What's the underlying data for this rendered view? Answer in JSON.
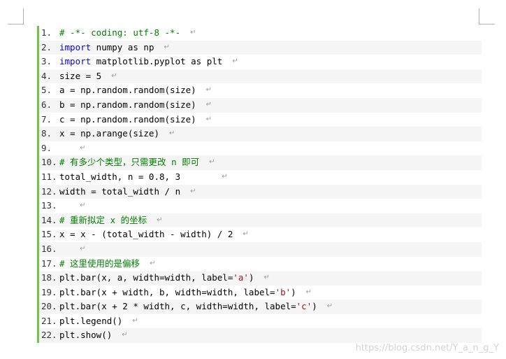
{
  "lines": [
    {
      "num": "1.",
      "segments": [
        {
          "t": "# -*- coding: utf-8 -*-",
          "c": "cm"
        }
      ]
    },
    {
      "num": "2.",
      "segments": [
        {
          "t": "import",
          "c": "kw"
        },
        {
          "t": " numpy as np",
          "c": ""
        }
      ]
    },
    {
      "num": "3.",
      "segments": [
        {
          "t": "import",
          "c": "kw"
        },
        {
          "t": " matplotlib.pyplot as plt",
          "c": ""
        }
      ]
    },
    {
      "num": "4.",
      "segments": [
        {
          "t": "size = 5",
          "c": ""
        }
      ]
    },
    {
      "num": "5.",
      "segments": [
        {
          "t": "a = np.random.random(size)",
          "c": ""
        }
      ]
    },
    {
      "num": "6.",
      "segments": [
        {
          "t": "b = np.random.random(size)",
          "c": ""
        }
      ]
    },
    {
      "num": "7.",
      "segments": [
        {
          "t": "c = np.random.random(size)",
          "c": ""
        }
      ]
    },
    {
      "num": "8.",
      "segments": [
        {
          "t": "x = np.arange(size)",
          "c": ""
        }
      ]
    },
    {
      "num": "9.",
      "segments": [
        {
          "t": "  ",
          "c": ""
        }
      ]
    },
    {
      "num": "10.",
      "segments": [
        {
          "t": "# 有多少个类型，只需更改 n 即可",
          "c": "cm"
        }
      ]
    },
    {
      "num": "11.",
      "segments": [
        {
          "t": "total_width, n = 0.8, 3      ",
          "c": ""
        }
      ]
    },
    {
      "num": "12.",
      "segments": [
        {
          "t": "width = total_width / n",
          "c": ""
        }
      ]
    },
    {
      "num": "13.",
      "segments": [
        {
          "t": "  ",
          "c": ""
        }
      ]
    },
    {
      "num": "14.",
      "segments": [
        {
          "t": "# 重新拟定 x 的坐标",
          "c": "cm"
        }
      ]
    },
    {
      "num": "15.",
      "segments": [
        {
          "t": "x = x - (total_width - width) / 2",
          "c": ""
        }
      ]
    },
    {
      "num": "16.",
      "segments": [
        {
          "t": "  ",
          "c": ""
        }
      ]
    },
    {
      "num": "17.",
      "segments": [
        {
          "t": "# 这里使用的是偏移",
          "c": "cm"
        }
      ]
    },
    {
      "num": "18.",
      "segments": [
        {
          "t": "plt.bar(x, a, width=width, label=",
          "c": ""
        },
        {
          "t": "'a'",
          "c": "str"
        },
        {
          "t": ")",
          "c": ""
        }
      ]
    },
    {
      "num": "19.",
      "segments": [
        {
          "t": "plt.bar(x + width, b, width=width, label=",
          "c": ""
        },
        {
          "t": "'b'",
          "c": "str"
        },
        {
          "t": ")",
          "c": ""
        }
      ]
    },
    {
      "num": "20.",
      "segments": [
        {
          "t": "plt.bar(x + 2 * width, c, width=width, label=",
          "c": ""
        },
        {
          "t": "'c'",
          "c": "str"
        },
        {
          "t": ")",
          "c": ""
        }
      ]
    },
    {
      "num": "21.",
      "segments": [
        {
          "t": "plt.legend()",
          "c": ""
        }
      ]
    },
    {
      "num": "22.",
      "segments": [
        {
          "t": "plt.show()",
          "c": ""
        }
      ]
    }
  ],
  "paragraph_mark": "↵",
  "watermark": "https://blog.csdn.net/Y_a_n_g_Y",
  "colors": {
    "keyword": "#0000ff",
    "comment": "#008000",
    "string": "#a31515",
    "gutter_bar": "#6cc644"
  }
}
